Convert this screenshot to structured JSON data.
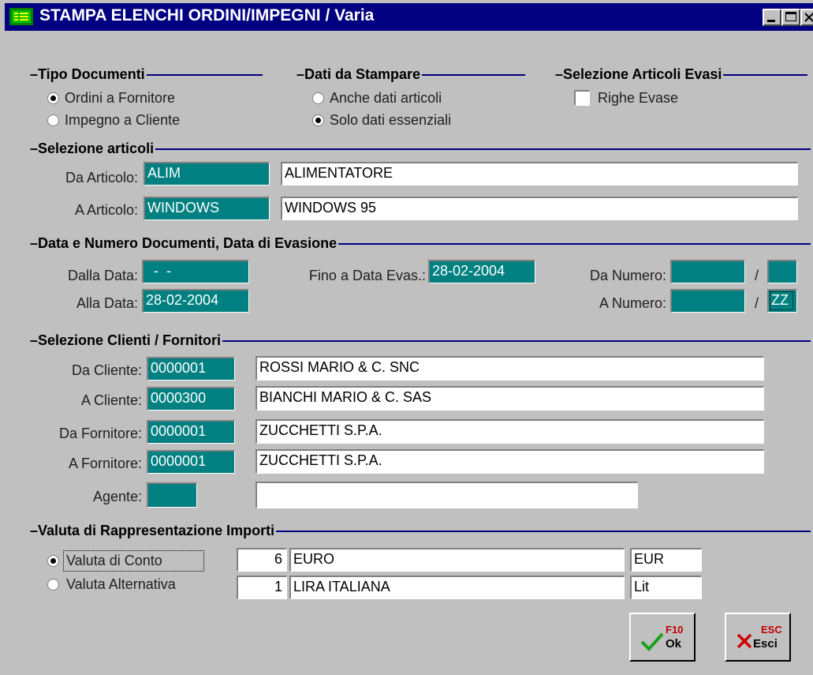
{
  "window": {
    "title": "STAMPA ELENCHI ORDINI/IMPEGNI / Varia",
    "controls": [
      "minimize-icon",
      "maximize-icon",
      "close-icon"
    ]
  },
  "tipo_documenti": {
    "heading": "Tipo Documenti",
    "options": [
      {
        "label": "Ordini a Fornitore",
        "selected": true
      },
      {
        "label": "Impegno a Cliente",
        "selected": false
      }
    ]
  },
  "dati_stampare": {
    "heading": "Dati da Stampare",
    "options": [
      {
        "label": "Anche dati articoli",
        "selected": false
      },
      {
        "label": "Solo dati essenziali",
        "selected": true
      }
    ]
  },
  "selezione_evasi": {
    "heading": "Selezione Articoli Evasi",
    "checkbox_label": "Righe Evase",
    "checked": false
  },
  "selezione_articoli": {
    "heading": "Selezione articoli",
    "da": {
      "label": "Da Articolo:",
      "code": "ALIM",
      "desc": "ALIMENTATORE"
    },
    "a": {
      "label": "A Articolo:",
      "code": "WINDOWS",
      "desc": "WINDOWS 95"
    }
  },
  "data_numero": {
    "heading": "Data e Numero Documenti, Data di Evasione",
    "dalla_data": {
      "label": "Dalla Data:",
      "value": "  -  -"
    },
    "alla_data": {
      "label": "Alla Data:",
      "value": "28-02-2004"
    },
    "fino_evas": {
      "label": "Fino a Data Evas.:",
      "value": "28-02-2004"
    },
    "da_numero": {
      "label": "Da Numero:",
      "value": "",
      "sep": "/",
      "serie": ""
    },
    "a_numero": {
      "label": "A Numero:",
      "value": "",
      "sep": "/",
      "serie": "ZZ"
    }
  },
  "clienti_fornitori": {
    "heading": "Selezione Clienti / Fornitori",
    "rows": [
      {
        "label": "Da Cliente:",
        "code": "0000001",
        "desc": "ROSSI MARIO & C. SNC"
      },
      {
        "label": "A Cliente:",
        "code": "0000300",
        "desc": "BIANCHI MARIO & C. SAS"
      },
      {
        "label": "Da Fornitore:",
        "code": "0000001",
        "desc": "ZUCCHETTI S.P.A."
      },
      {
        "label": "A Fornitore:",
        "code": "0000001",
        "desc": "ZUCCHETTI S.P.A."
      }
    ],
    "agente": {
      "label": "Agente:",
      "code": "",
      "desc": ""
    }
  },
  "valuta": {
    "heading": "Valuta di Rappresentazione Importi",
    "options": [
      {
        "label": "Valuta di Conto",
        "selected": true,
        "num": "6",
        "name": "EURO",
        "sym": "EUR"
      },
      {
        "label": "Valuta Alternativa",
        "selected": false,
        "num": "1",
        "name": "LIRA ITALIANA",
        "sym": "Lit"
      }
    ]
  },
  "buttons": {
    "ok": {
      "key": "F10",
      "label": "Ok"
    },
    "esci": {
      "key": "ESC",
      "label": "Esci"
    }
  },
  "colors": {
    "titlebar": "#000080",
    "window_bg": "#c0c0c0",
    "field_teal": "#008080",
    "section_line": "#000080",
    "ok_check": "#1aa01a",
    "esci_x": "#d00000"
  }
}
